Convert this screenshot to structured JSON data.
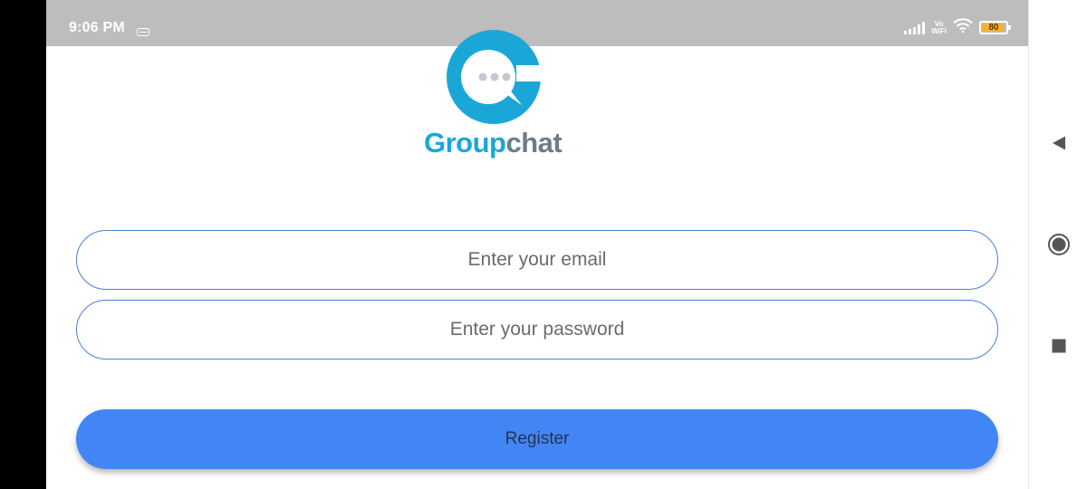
{
  "status_bar": {
    "time": "9:06 PM",
    "network_label_top": "Vo",
    "network_label_bottom": "WiFi",
    "battery_level": "80"
  },
  "app": {
    "logo_text_group": "Group",
    "logo_text_chat": "chat",
    "brand_colors": {
      "primary": "#1aa7d8",
      "secondary": "#6d7d88",
      "dots": "#c4c9cf"
    }
  },
  "form": {
    "email_placeholder": "Enter your email",
    "email_value": "",
    "password_placeholder": "Enter your password",
    "password_value": "",
    "register_label": "Register",
    "accent_color": "#4286f5",
    "field_border_color": "#4a7fd4"
  },
  "nav": {
    "back_icon": "back-triangle-icon",
    "home_icon": "home-circle-icon",
    "recents_icon": "recents-square-icon"
  }
}
